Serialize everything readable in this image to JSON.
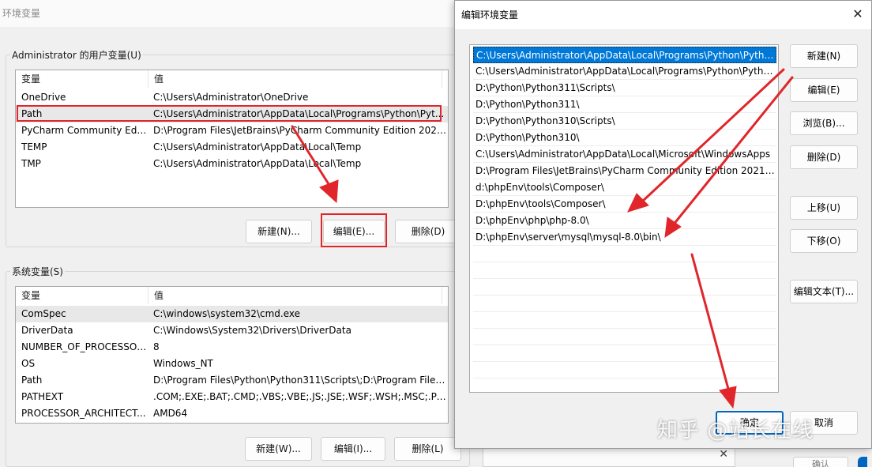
{
  "env_window": {
    "title": "环境变量",
    "user_group_label": "Administrator 的用户变量(U)",
    "columns": [
      "变量",
      "值"
    ],
    "user_vars": [
      {
        "name": "OneDrive",
        "value": "C:\\Users\\Administrator\\OneDrive"
      },
      {
        "name": "Path",
        "value": "C:\\Users\\Administrator\\AppData\\Local\\Programs\\Python\\Pyt..."
      },
      {
        "name": "PyCharm Community Editi...",
        "value": "D:\\Program Files\\JetBrains\\PyCharm Community Edition 2021..."
      },
      {
        "name": "TEMP",
        "value": "C:\\Users\\Administrator\\AppData\\Local\\Temp"
      },
      {
        "name": "TMP",
        "value": "C:\\Users\\Administrator\\AppData\\Local\\Temp"
      }
    ],
    "user_buttons": {
      "new": "新建(N)...",
      "edit": "编辑(E)...",
      "delete": "删除(D)"
    },
    "system_group_label": "系统变量(S)",
    "system_vars": [
      {
        "name": "ComSpec",
        "value": "C:\\windows\\system32\\cmd.exe"
      },
      {
        "name": "DriverData",
        "value": "C:\\Windows\\System32\\Drivers\\DriverData"
      },
      {
        "name": "NUMBER_OF_PROCESSORS",
        "value": "8"
      },
      {
        "name": "OS",
        "value": "Windows_NT"
      },
      {
        "name": "Path",
        "value": "D:\\Program Files\\Python\\Python311\\Scripts\\;D:\\Program Files..."
      },
      {
        "name": "PATHEXT",
        "value": ".COM;.EXE;.BAT;.CMD;.VBS;.VBE;.JS;.JSE;.WSF;.WSH;.MSC;.PY;.P..."
      },
      {
        "name": "PROCESSOR_ARCHITECT...",
        "value": "AMD64"
      }
    ],
    "system_buttons": {
      "new": "新建(W)...",
      "edit": "编辑(I)...",
      "delete": "删除(L)"
    }
  },
  "edit_dialog": {
    "title": "编辑环境变量",
    "paths": [
      "C:\\Users\\Administrator\\AppData\\Local\\Programs\\Python\\Pytho...",
      "C:\\Users\\Administrator\\AppData\\Local\\Programs\\Python\\Pytho...",
      "D:\\Python\\Python311\\Scripts\\",
      "D:\\Python\\Python311\\",
      "D:\\Python\\Python310\\Scripts\\",
      "D:\\Python\\Python310\\",
      "C:\\Users\\Administrator\\AppData\\Local\\Microsoft\\WindowsApps",
      "D:\\Program Files\\JetBrains\\PyCharm Community Edition 2021.2....",
      "d:\\phpEnv\\tools\\Composer\\",
      "D:\\phpEnv\\tools\\Composer\\",
      "D:\\phpEnv\\php\\php-8.0\\",
      "D:\\phpEnv\\server\\mysql\\mysql-8.0\\bin\\"
    ],
    "buttons": {
      "new": "新建(N)",
      "edit": "编辑(E)",
      "browse": "浏览(B)...",
      "delete": "删除(D)",
      "move_up": "上移(U)",
      "move_down": "下移(O)",
      "edit_text": "编辑文本(T)...",
      "ok": "确定",
      "cancel": "取消"
    }
  },
  "watermark": "知乎 @站长在线",
  "behind_button": "确认",
  "colors": {
    "annotation_red": "#e0262b",
    "selection_blue": "#0078d7"
  }
}
